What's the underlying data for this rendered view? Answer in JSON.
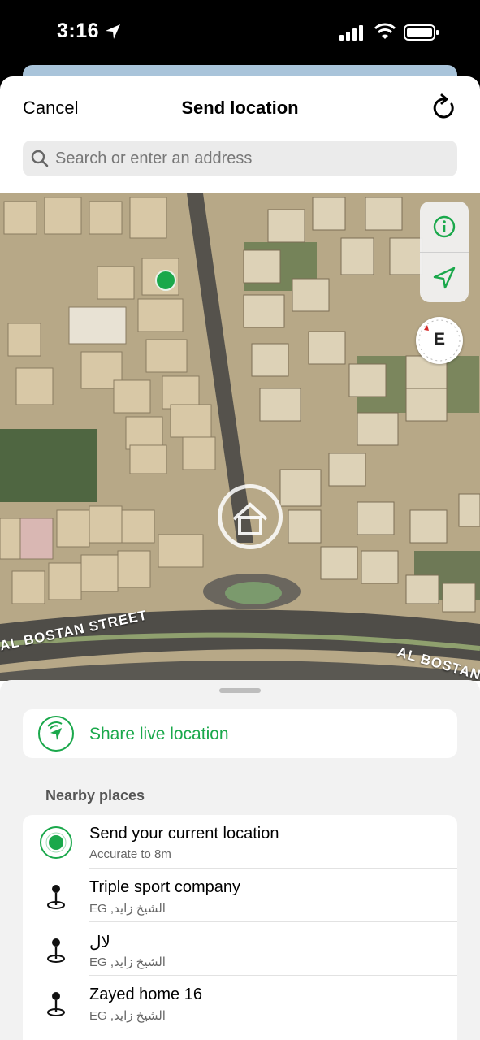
{
  "status_bar": {
    "time": "3:16"
  },
  "nav": {
    "cancel_label": "Cancel",
    "title": "Send location"
  },
  "search": {
    "placeholder": "Search or enter an address"
  },
  "map": {
    "compass_label": "E",
    "street_left": "AL BOSTAN STREET",
    "street_right": "AL BOSTAN S"
  },
  "live": {
    "label": "Share live location"
  },
  "nearby": {
    "section_title": "Nearby places",
    "items": [
      {
        "title": "Send your current location",
        "subtitle": "Accurate to 8m",
        "icon": "current-location-icon"
      },
      {
        "title": "Triple sport company",
        "subtitle": "EG ,الشيخ زايد",
        "icon": "map-pin-icon"
      },
      {
        "title": "لال",
        "subtitle": "EG ,الشيخ زايد",
        "icon": "map-pin-icon"
      },
      {
        "title": "Zayed home 16",
        "subtitle": "EG ,الشيخ زايد",
        "icon": "map-pin-icon"
      }
    ]
  },
  "colors": {
    "accent": "#1aa84b",
    "search_bg": "#ebebeb",
    "panel_bg": "#f2f2f2"
  }
}
